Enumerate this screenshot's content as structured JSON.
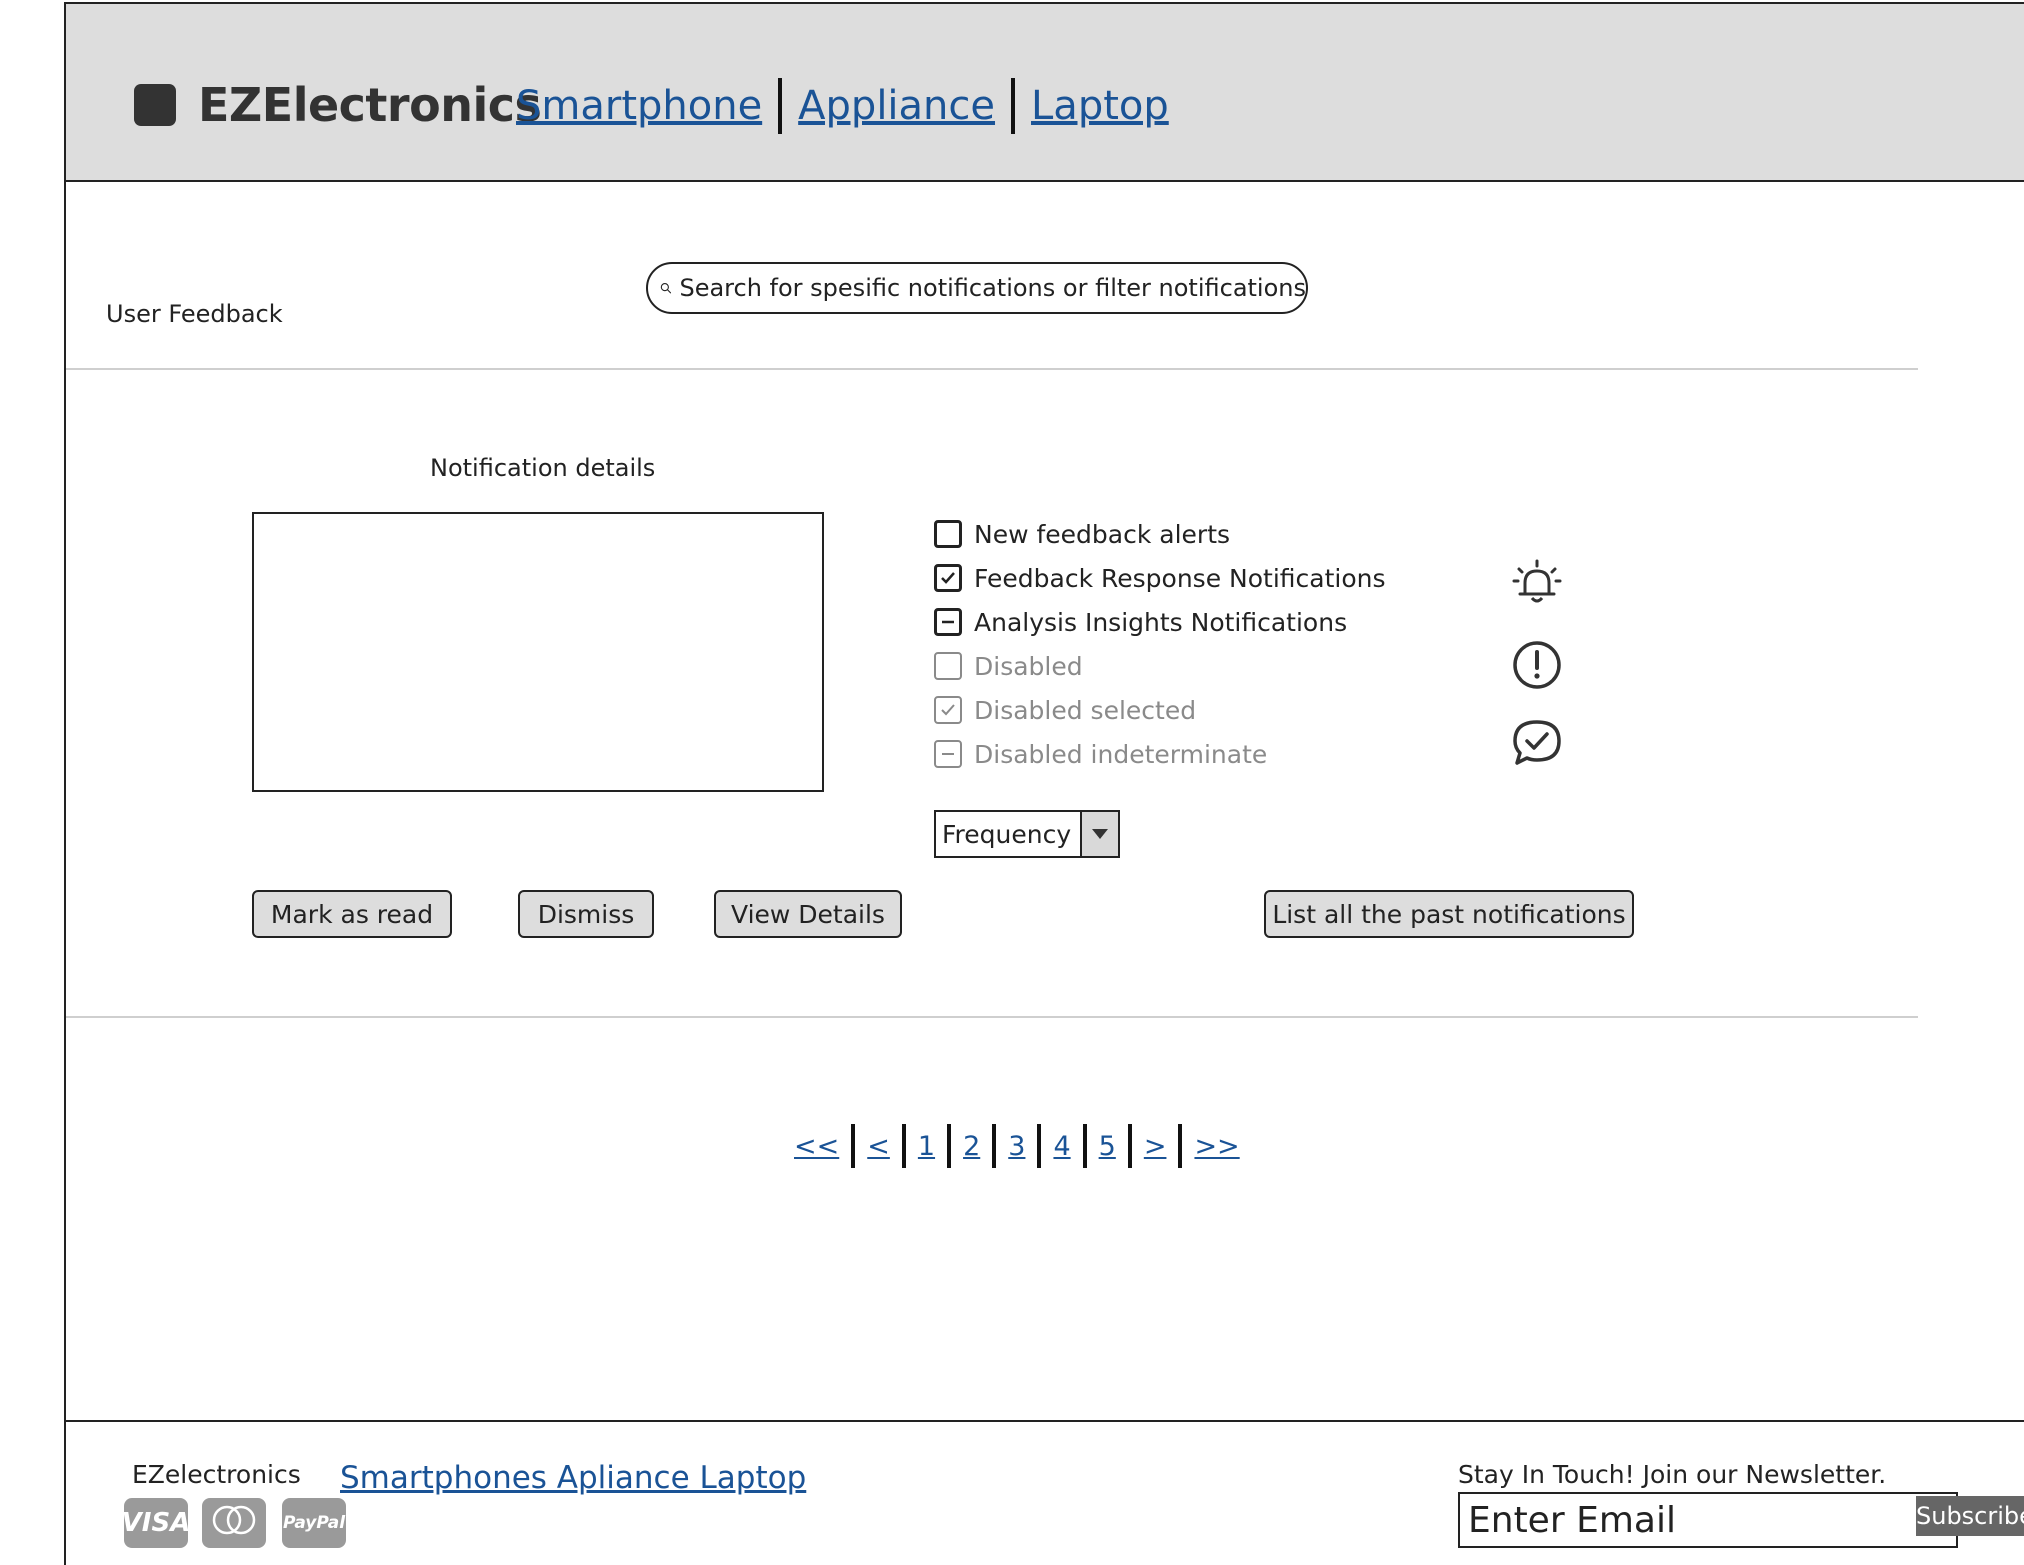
{
  "header": {
    "brand": "EZElectronics",
    "nav": [
      "Smartphone",
      "Appliance",
      "Laptop"
    ]
  },
  "main": {
    "section_title": "User Feedback",
    "search_placeholder": "Search for spesific notifications  or filter notifications",
    "details_title": "Notification details",
    "checkboxes": [
      {
        "label": "New feedback alerts",
        "state": "unchecked",
        "disabled": false
      },
      {
        "label": "Feedback Response Notifications",
        "state": "checked",
        "disabled": false
      },
      {
        "label": "Analysis Insights Notifications",
        "state": "indeterminate",
        "disabled": false
      },
      {
        "label": "Disabled",
        "state": "unchecked",
        "disabled": true
      },
      {
        "label": "Disabled selected",
        "state": "checked",
        "disabled": true
      },
      {
        "label": "Disabled indeterminate",
        "state": "indeterminate",
        "disabled": true
      }
    ],
    "side_icons": [
      "alarm-bell-icon",
      "alert-circle-icon",
      "chat-check-icon"
    ],
    "frequency_select": "Frequency",
    "buttons": {
      "mark_read": "Mark as read",
      "dismiss": "Dismiss",
      "view_details": "View Details",
      "list_past": "List all the past notifications"
    }
  },
  "pagination": [
    "<<",
    "<",
    "1",
    "2",
    "3",
    "4",
    "5",
    ">",
    ">>"
  ],
  "footer": {
    "brand": "EZelectronics",
    "links": "Smartphones Apliance Laptop",
    "payment": [
      "VISA",
      "mastercard",
      "PayPal"
    ],
    "newsletter_title": "Stay In Touch! Join our Newsletter.",
    "email_placeholder": "Enter Email",
    "subscribe": "Subscribe"
  },
  "colors": {
    "link": "#1a5396",
    "header_bg": "#dddddd",
    "button_bg": "#dddddd",
    "disabled_text": "#8a8a8a"
  }
}
